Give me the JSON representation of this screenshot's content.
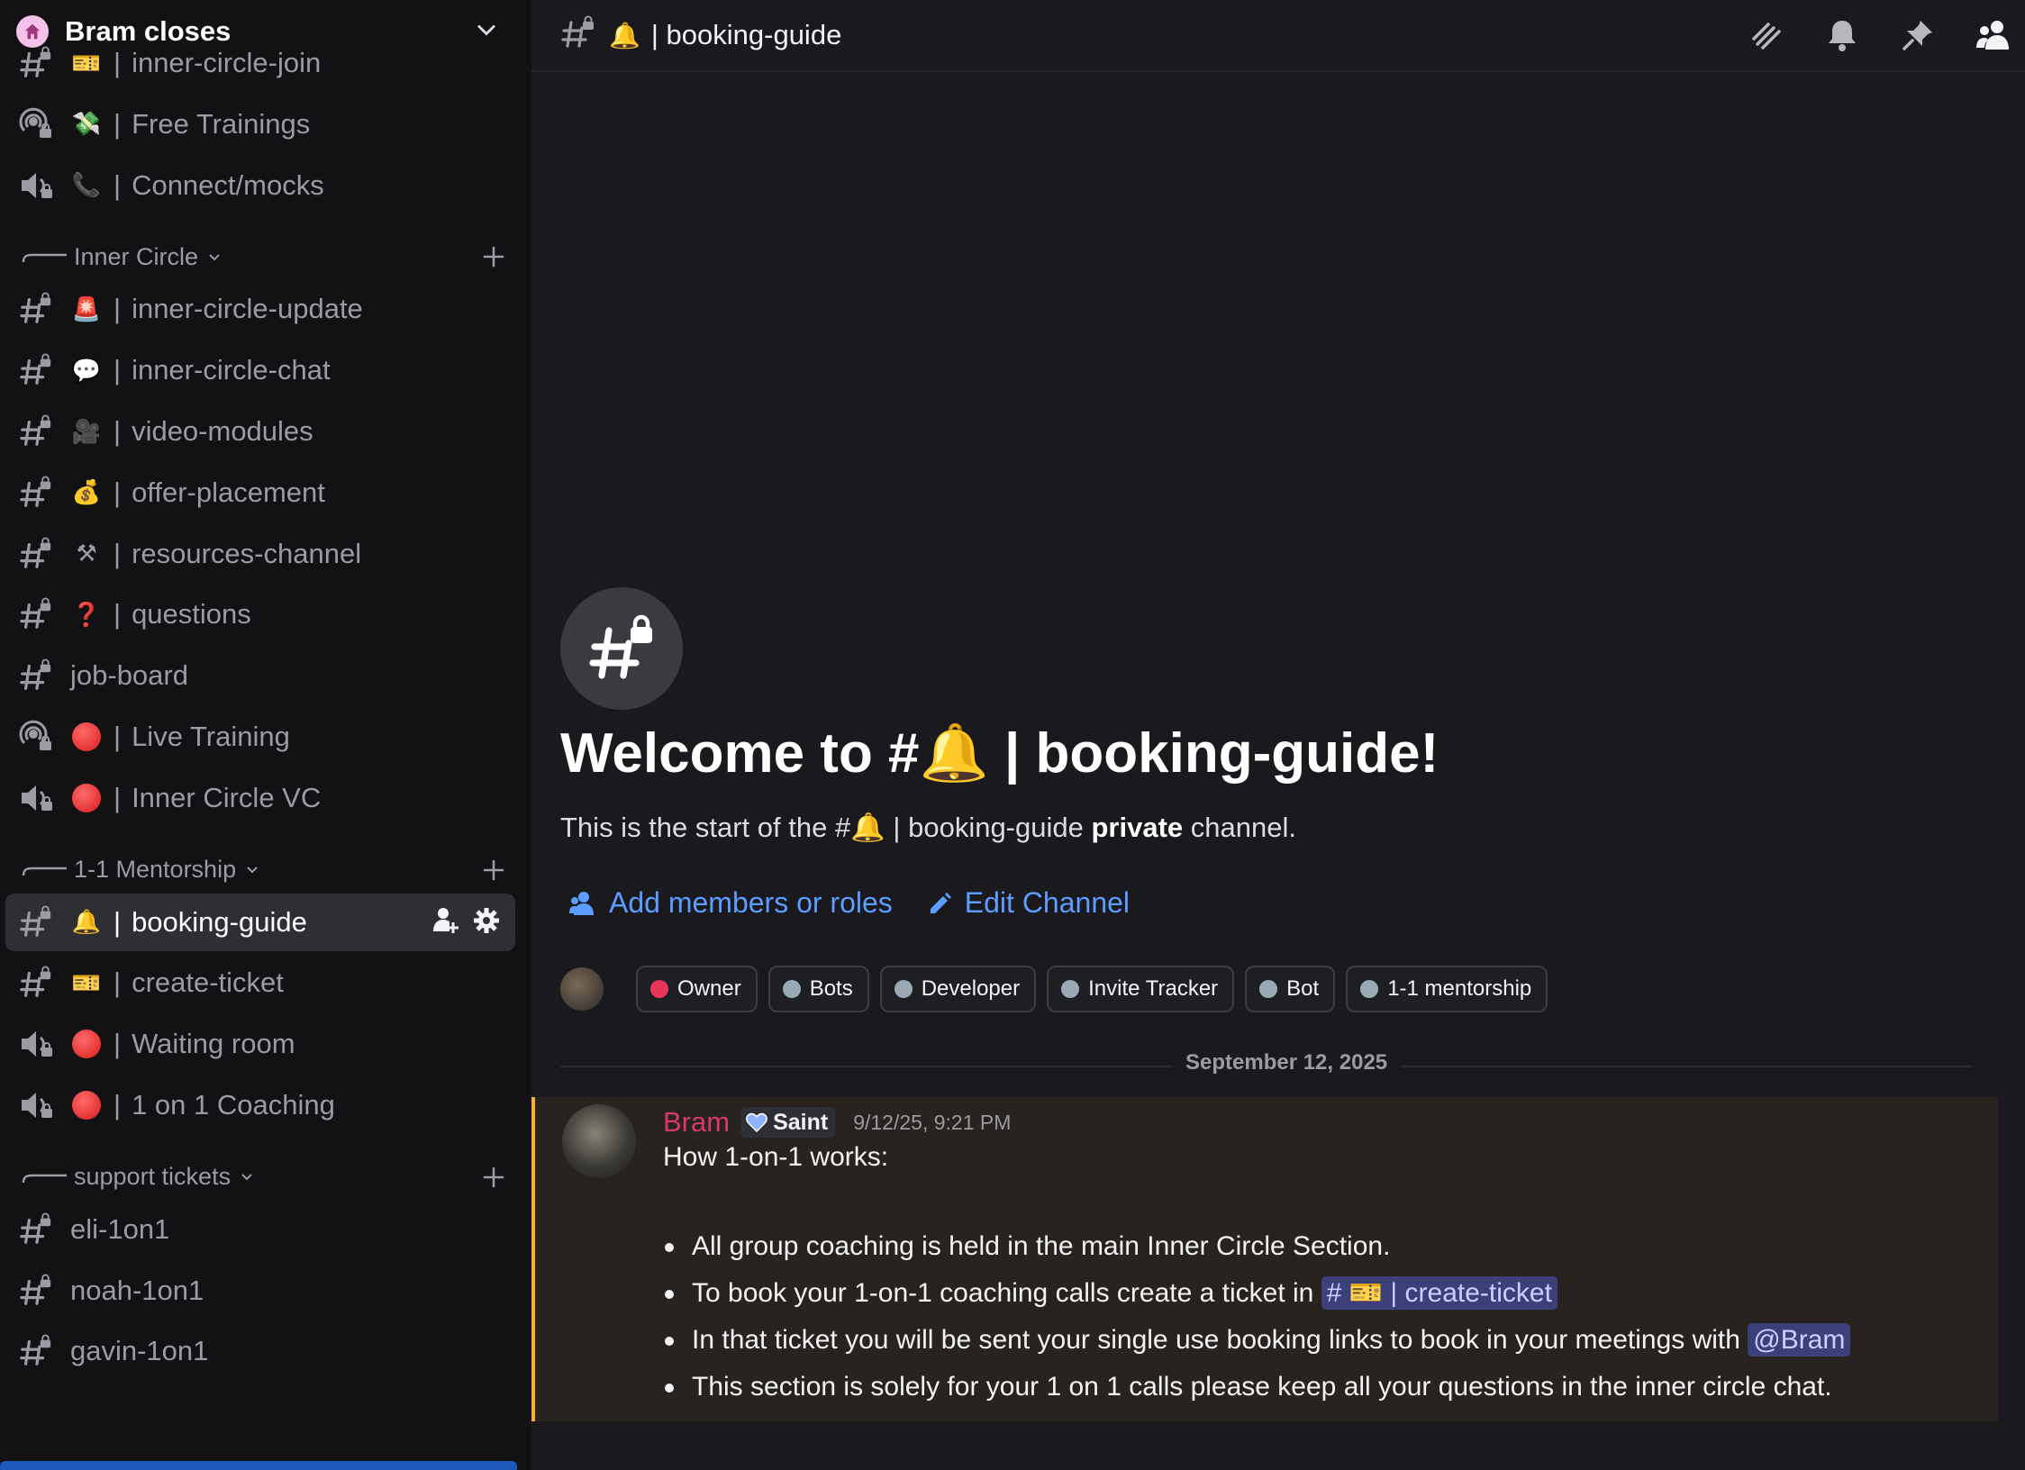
{
  "server": {
    "name": "Bram closes",
    "icon": "home-icon",
    "accent": "#f4c2e8"
  },
  "sidebar": {
    "channels_top": [
      {
        "label": "inner-circle-join",
        "emoji": "🎫",
        "type": "text"
      },
      {
        "label": "Free Trainings",
        "emoji": "💸",
        "type": "stage"
      },
      {
        "label": "Connect/mocks",
        "emoji": "📞",
        "type": "voice"
      }
    ],
    "categories": [
      {
        "name": "Inner Circle",
        "channels": [
          {
            "label": "inner-circle-update",
            "emoji": "🚨",
            "type": "text"
          },
          {
            "label": "inner-circle-chat",
            "emoji": "💬",
            "type": "text"
          },
          {
            "label": "video-modules",
            "emoji": "🎥",
            "type": "text"
          },
          {
            "label": "offer-placement",
            "emoji": "💰",
            "type": "text"
          },
          {
            "label": "resources-channel",
            "emoji": "⚒",
            "type": "text"
          },
          {
            "label": "questions",
            "emoji": "❓",
            "type": "text"
          },
          {
            "label": "job-board",
            "emoji": "",
            "type": "text"
          },
          {
            "label": "Live Training",
            "emoji": "🔴",
            "type": "stage"
          },
          {
            "label": "Inner Circle VC",
            "emoji": "🔴",
            "type": "voice"
          }
        ]
      },
      {
        "name": "1-1 Mentorship",
        "channels": [
          {
            "label": "booking-guide",
            "emoji": "🔔",
            "type": "text",
            "active": true
          },
          {
            "label": "create-ticket",
            "emoji": "🎫",
            "type": "text"
          },
          {
            "label": "Waiting room",
            "emoji": "🔴",
            "type": "voice"
          },
          {
            "label": "1 on 1 Coaching",
            "emoji": "🔴",
            "type": "voice"
          }
        ]
      },
      {
        "name": "support tickets",
        "channels": [
          {
            "label": "eli-1on1",
            "emoji": "",
            "type": "text"
          },
          {
            "label": "noah-1on1",
            "emoji": "",
            "type": "text"
          },
          {
            "label": "gavin-1on1",
            "emoji": "",
            "type": "text"
          }
        ]
      }
    ],
    "separator": "|"
  },
  "topbar": {
    "channel_emoji": "🔔",
    "channel_title": "| booking-guide",
    "actions": [
      "threads-icon",
      "bell-icon",
      "pin-icon",
      "members-icon"
    ]
  },
  "welcome": {
    "title_prefix": "Welcome to #",
    "title_emoji": "🔔",
    "title_suffix": " | booking-guide!",
    "sub_prefix": "This is the start of the #",
    "sub_emoji": "🔔",
    "sub_channel": " | booking-guide ",
    "sub_bold": "private",
    "sub_suffix": " channel.",
    "add_members_label": "Add members or roles",
    "edit_channel_label": "Edit Channel",
    "roles": [
      {
        "name": "Owner",
        "color": "#e8345b"
      },
      {
        "name": "Bots",
        "color": "#99aab5"
      },
      {
        "name": "Developer",
        "color": "#99aab5"
      },
      {
        "name": "Invite Tracker",
        "color": "#99aab5"
      },
      {
        "name": "Bot",
        "color": "#99aab5"
      },
      {
        "name": "1-1 mentorship",
        "color": "#99aab5"
      }
    ]
  },
  "divider": {
    "date": "September 12, 2025"
  },
  "message": {
    "author": "Bram",
    "author_color": "#d8396b",
    "badge": "Saint",
    "timestamp": "9/12/25, 9:21 PM",
    "first_line": "How 1-on-1 works:",
    "bullets": [
      {
        "text": "All group coaching is held in the main Inner Circle Section."
      },
      {
        "text": "To book your 1-on-1 coaching calls create a ticket in ",
        "mention": "# 🎫 | create-ticket"
      },
      {
        "text": "In that ticket you will be sent your single use booking links to book in your meetings with ",
        "mention": "@Bram"
      },
      {
        "text": "This section is solely for your 1 on 1 calls please keep all your questions in the inner circle chat."
      }
    ]
  },
  "colors": {
    "link": "#5c9dff",
    "mention_bg": "#3b3f7a",
    "message_highlight": "#f0b232"
  }
}
